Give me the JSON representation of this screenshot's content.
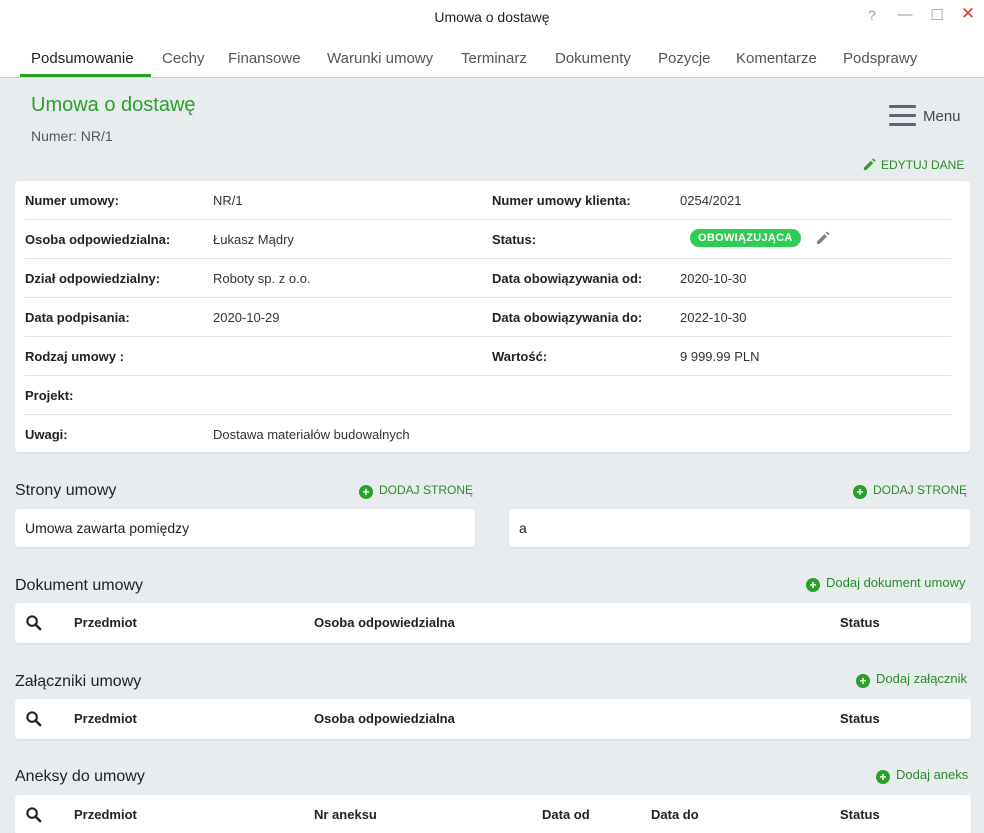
{
  "window": {
    "title": "Umowa o dostawę",
    "help_glyph": "?",
    "min_glyph": "—",
    "max_glyph": "☐",
    "close_glyph": "✕"
  },
  "tabs": [
    {
      "label": "Podsumowanie",
      "active": true
    },
    {
      "label": "Cechy"
    },
    {
      "label": "Finansowe"
    },
    {
      "label": "Warunki umowy"
    },
    {
      "label": "Terminarz"
    },
    {
      "label": "Dokumenty"
    },
    {
      "label": "Pozycje"
    },
    {
      "label": "Komentarze"
    },
    {
      "label": "Podsprawy"
    }
  ],
  "header": {
    "title": "Umowa o dostawę",
    "number": "Numer: NR/1",
    "menu_label": "Menu"
  },
  "details": {
    "edit_label": "EDYTUJ DANE",
    "rows": [
      {
        "l1": "Numer umowy:",
        "v1": "NR/1",
        "l2": "Numer umowy klienta:",
        "v2": "0254/2021"
      },
      {
        "l1": "Osoba odpowiedzialna:",
        "v1": "Łukasz Mądry",
        "l2": "Status:",
        "v2": ""
      },
      {
        "l1": "Dział odpowiedzialny:",
        "v1": "Roboty sp. z o.o.",
        "l2": "Data obowiązywania od:",
        "v2": "2020-10-30"
      },
      {
        "l1": "Data podpisania:",
        "v1": "2020-10-29",
        "l2": "Data obowiązywania do:",
        "v2": "2022-10-30"
      },
      {
        "l1": "Rodzaj umowy :",
        "v1": "",
        "l2": "Wartość:",
        "v2": "9 999.99 PLN"
      },
      {
        "l1": "Projekt:",
        "v1": "",
        "l2": "",
        "v2": ""
      },
      {
        "l1": "Uwagi:",
        "v1": "Dostawa materiałów budowalnych",
        "l2": "",
        "v2": ""
      }
    ],
    "status_badge": "OBOWIĄZUJĄCA",
    "status_color": "#2ecc55"
  },
  "parties": {
    "title": "Strony umowy",
    "add_left": "DODAJ STRONĘ",
    "add_right": "DODAJ STRONĘ",
    "left_text": "Umowa zawarta pomiędzy",
    "right_text": "a"
  },
  "documents": {
    "title": "Dokument umowy",
    "add": "Dodaj dokument umowy",
    "headers": [
      "Przedmiot",
      "Osoba odpowiedzialna",
      "Status"
    ]
  },
  "attachments": {
    "title": "Załączniki umowy",
    "add": "Dodaj załącznik",
    "headers": [
      "Przedmiot",
      "Osoba odpowiedzialna",
      "Status"
    ]
  },
  "annexes": {
    "title": "Aneksy do umowy",
    "add": "Dodaj aneks",
    "headers": [
      "Przedmiot",
      "Nr aneksu",
      "Data od",
      "Data do",
      "Status"
    ]
  },
  "colors": {
    "accent": "#2aa02a",
    "background": "#e9ecee",
    "close": "#e03b2f"
  }
}
